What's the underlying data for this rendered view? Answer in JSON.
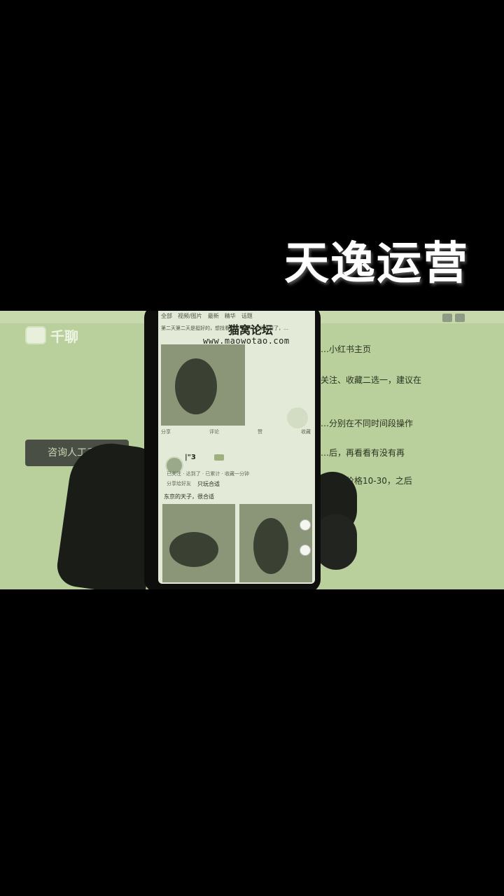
{
  "overlay": {
    "title": "天逸运营"
  },
  "monitor": {
    "brand_name": "千聊",
    "consult_button": "咨询人工千聊",
    "right_lines": [
      "…小红书主页",
      "关注、收藏二选一，建议在",
      "…分别在不同时间段操作",
      "…后，再看看有没有再",
      "…活动价格10-30，之后"
    ]
  },
  "phone": {
    "tabs": [
      "全部",
      "视频/图片",
      "最新",
      "精华",
      "话题"
    ],
    "desc": "第二天第二天是挺好的，想找看看能不能可以就是要了，…",
    "watermark_title": "猫窝论坛",
    "watermark_url": "www.maowotao.com",
    "actions": [
      "分享",
      "评论",
      "赞",
      "收藏"
    ],
    "user": {
      "name": "|\"3",
      "badge": ""
    },
    "meta_line_1": "已关注 · 达到了 · 已累计 · 收藏一分钟",
    "meta_line_2": "分享给好友",
    "meta_strong": "只玩合适",
    "caption": "东京的天子，很合适"
  },
  "colors": {
    "background": "#000000",
    "monitor": "#b9cf9c",
    "screen": "#e4ead8",
    "button": "#4a4f45"
  }
}
